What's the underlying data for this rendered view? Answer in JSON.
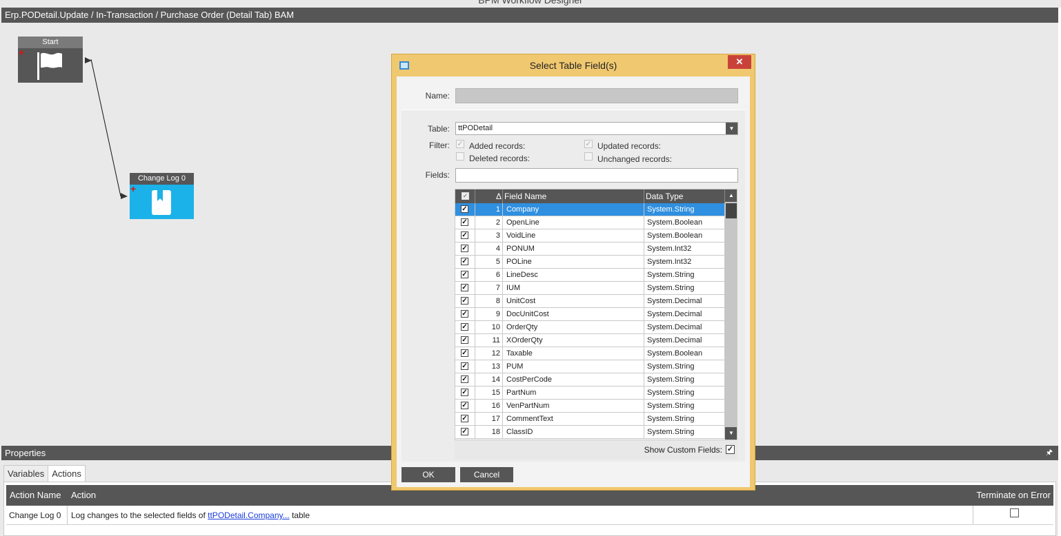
{
  "app": {
    "title": "BPM Workflow Designer"
  },
  "designer": {
    "header": "Erp.PODetail.Update / In-Transaction / Purchase Order (Detail Tab) BAM"
  },
  "nodes": {
    "start": {
      "title": "Start",
      "icon": "flag-icon"
    },
    "changelog": {
      "title": "Change Log 0",
      "icon": "log-book-icon",
      "color": "#1ab2e8"
    }
  },
  "properties": {
    "title": "Properties",
    "tabs": [
      {
        "label": "Variables"
      },
      {
        "label": "Actions"
      }
    ],
    "active_tab": "Actions",
    "columns": {
      "action_name": "Action Name",
      "action": "Action",
      "terminate": "Terminate on Error"
    },
    "rows": [
      {
        "name": "Change Log 0",
        "action_prefix": "Log changes to the selected fields of ",
        "action_link": "ttPODetail.Company...",
        "action_suffix": " table",
        "terminate": false
      }
    ]
  },
  "dialog": {
    "title": "Select Table Field(s)",
    "name_label": "Name:",
    "name_value": "",
    "table_label": "Table:",
    "table_value": "ttPODetail",
    "filter_label": "Filter:",
    "filters": {
      "added": {
        "label": "Added records:",
        "checked": true
      },
      "updated": {
        "label": "Updated records:",
        "checked": true
      },
      "deleted": {
        "label": "Deleted records:",
        "checked": false
      },
      "unchanged": {
        "label": "Unchanged records:",
        "checked": false
      }
    },
    "fields_label": "Fields:",
    "fields_value": "",
    "grid": {
      "col_sort": "Δ",
      "col_field": "Field Name",
      "col_type": "Data Type",
      "rows": [
        {
          "num": "1",
          "field": "Company",
          "type": "System.String",
          "selected": true
        },
        {
          "num": "2",
          "field": "OpenLine",
          "type": "System.Boolean"
        },
        {
          "num": "3",
          "field": "VoidLine",
          "type": "System.Boolean"
        },
        {
          "num": "4",
          "field": "PONUM",
          "type": "System.Int32"
        },
        {
          "num": "5",
          "field": "POLine",
          "type": "System.Int32"
        },
        {
          "num": "6",
          "field": "LineDesc",
          "type": "System.String"
        },
        {
          "num": "7",
          "field": "IUM",
          "type": "System.String"
        },
        {
          "num": "8",
          "field": "UnitCost",
          "type": "System.Decimal"
        },
        {
          "num": "9",
          "field": "DocUnitCost",
          "type": "System.Decimal"
        },
        {
          "num": "10",
          "field": "OrderQty",
          "type": "System.Decimal"
        },
        {
          "num": "11",
          "field": "XOrderQty",
          "type": "System.Decimal"
        },
        {
          "num": "12",
          "field": "Taxable",
          "type": "System.Boolean"
        },
        {
          "num": "13",
          "field": "PUM",
          "type": "System.String"
        },
        {
          "num": "14",
          "field": "CostPerCode",
          "type": "System.String"
        },
        {
          "num": "15",
          "field": "PartNum",
          "type": "System.String"
        },
        {
          "num": "16",
          "field": "VenPartNum",
          "type": "System.String"
        },
        {
          "num": "17",
          "field": "CommentText",
          "type": "System.String"
        },
        {
          "num": "18",
          "field": "ClassID",
          "type": "System.String"
        }
      ]
    },
    "show_custom_label": "Show Custom Fields:",
    "show_custom_checked": true,
    "ok_label": "OK",
    "cancel_label": "Cancel"
  }
}
